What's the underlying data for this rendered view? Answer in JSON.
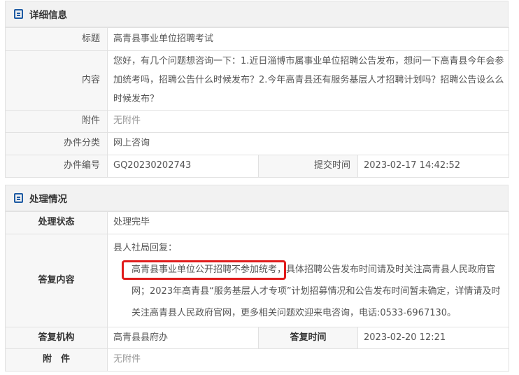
{
  "detail": {
    "header": "详细信息",
    "title_label": "标题",
    "title_value": "高青县事业单位招聘考试",
    "content_label": "内容",
    "content_value": "您好，有几个问题想咨询一下：1.近日淄博市属事业单位招聘公告发布，想问一下高青县今年会参加统考吗，招聘公告什么时候发布？2.今年高青县还有服务基层人才招聘计划吗？招聘公告设么么时候发布？",
    "attachment_label": "附件",
    "attachment_value": "无附件",
    "category_label": "办件分类",
    "category_value": "网上咨询",
    "number_label": "办件编号",
    "number_value": "GQ20230202743",
    "submit_time_label": "提交时间",
    "submit_time_value": "2023-02-17 14:42:52"
  },
  "handling": {
    "header": "处理情况",
    "status_label": "处理状态",
    "status_value": "处理完毕",
    "reply_label": "答复内容",
    "reply_line1": "县人社局回复：",
    "reply_line2": "高青县事业单位公开招聘不参加统考，具体招聘公告发布时间请及时关注高青县人民政府官网；2023年高青县“服务基层人才专项”计划招募情况和公告发布时间暂未确定，详情请及时关注高青县人民政府官网，更多相关问题欢迎来电咨询，电话:0533-6967130。",
    "org_label": "答复机构",
    "org_value": "高青县县府办",
    "reply_time_label": "答复时间",
    "reply_time_value": "2023-02-20 12:21",
    "attachment_label": "附　件",
    "attachment_value": "无附件"
  },
  "colors": {
    "accent": "#1d5aa3",
    "highlight": "#e01b1b"
  },
  "icons": {
    "section_icon": "document-list-icon"
  }
}
